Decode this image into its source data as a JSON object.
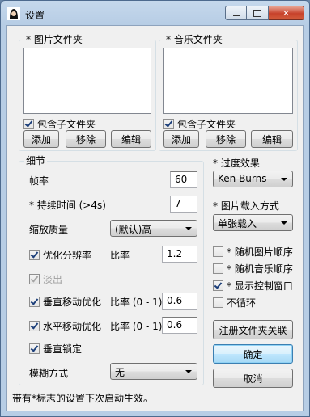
{
  "window": {
    "title": "设置"
  },
  "pictures_group": {
    "legend": "* 图片文件夹",
    "include_subfolders": "包含子文件夹",
    "include_checked": true,
    "add": "添加",
    "remove": "移除",
    "edit": "编辑"
  },
  "music_group": {
    "legend": "* 音乐文件夹",
    "include_subfolders": "包含子文件夹",
    "include_checked": true,
    "add": "添加",
    "remove": "移除",
    "edit": "编辑"
  },
  "details": {
    "legend": "细节",
    "frame_rate_label": "帧率",
    "frame_rate_value": "60",
    "duration_label": "* 持续时间 (>4s)",
    "duration_value": "7",
    "scale_quality_label": "缩放质量",
    "scale_quality_value": "(默认)高",
    "optimize_resolution_label": "优化分辨率",
    "optimize_resolution_checked": true,
    "ratio_label": "比率",
    "ratio_value": "1.2",
    "fade_out_label": "淡出",
    "fade_out_checked": true,
    "vertical_move_label": "垂直移动优化",
    "vertical_move_checked": true,
    "vertical_ratio_label": "比率 (0 - 1)",
    "vertical_ratio_value": "0.6",
    "horizontal_move_label": "水平移动优化",
    "horizontal_move_checked": true,
    "horizontal_ratio_label": "比率 (0 - 1)",
    "horizontal_ratio_value": "0.6",
    "vertical_lock_label": "垂直锁定",
    "vertical_lock_checked": true,
    "blur_mode_label": "模糊方式",
    "blur_mode_value": "无"
  },
  "right": {
    "transition_label": "* 过度效果",
    "transition_value": "Ken Burns",
    "load_mode_label": "* 图片载入方式",
    "load_mode_value": "单张载入",
    "random_pictures": "* 随机图片顺序",
    "random_pictures_checked": false,
    "random_music": "* 随机音乐顺序",
    "random_music_checked": false,
    "show_control": "* 显示控制窗口",
    "show_control_checked": true,
    "no_loop": "不循环",
    "no_loop_checked": false,
    "register_button": "注册文件夹关联",
    "ok_button": "确定",
    "cancel_button": "取消"
  },
  "footer": "带有*标志的设置下次启动生效。",
  "colors": {
    "title_bar": "#b7cde5",
    "close_button": "#c7412b",
    "default_button_border": "#3c7fb1"
  }
}
